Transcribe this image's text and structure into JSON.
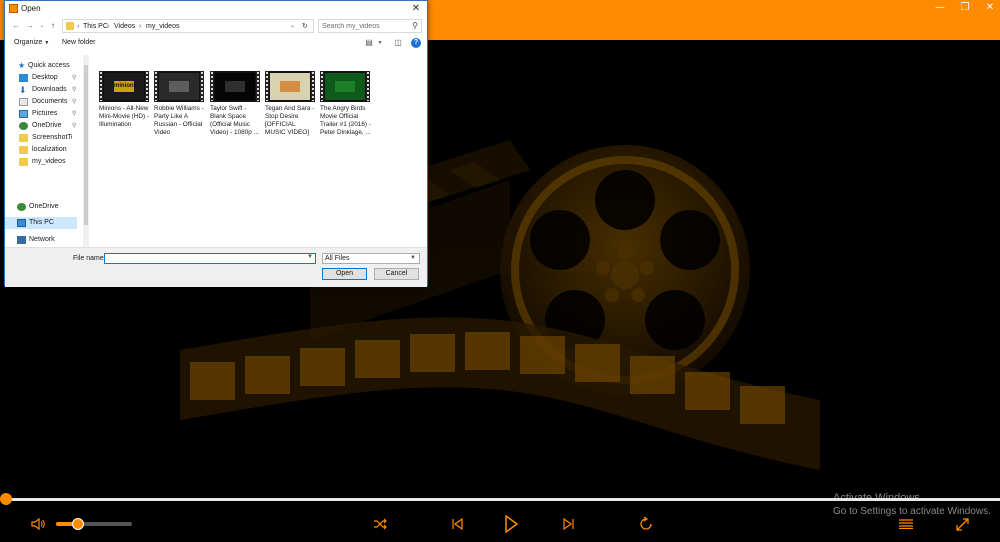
{
  "player": {
    "accent": "#ff8c00",
    "background": "#000000",
    "window_controls": [
      "minimize-icon",
      "maximize-icon",
      "close-icon"
    ],
    "playback_progress": 0,
    "volume_level": 0.3,
    "controls": [
      "volume-icon",
      "shuffle-icon",
      "previous-icon",
      "play-icon",
      "next-icon",
      "repeat-icon",
      "playlist-icon",
      "fullscreen-icon"
    ]
  },
  "watermark": {
    "line1": "Activate Windows",
    "line2": "Go to Settings to activate Windows."
  },
  "dialog": {
    "title": "Open",
    "breadcrumb": [
      "This PC",
      "Videos",
      "my_videos"
    ],
    "search_placeholder": "Search my_videos",
    "toolbar": {
      "organize": "Organize",
      "new_folder": "New folder"
    },
    "sidebar": {
      "quick_access": "Quick access",
      "items": [
        {
          "label": "Desktop",
          "icon": "desktop-icon",
          "pinned": true
        },
        {
          "label": "Downloads",
          "icon": "download-icon",
          "pinned": true
        },
        {
          "label": "Documents",
          "icon": "document-icon",
          "pinned": true
        },
        {
          "label": "Pictures",
          "icon": "picture-icon",
          "pinned": true
        },
        {
          "label": "OneDrive",
          "icon": "onedrive-icon",
          "pinned": true
        },
        {
          "label": "ScreenshotTo",
          "icon": "folder-icon",
          "pinned": false
        },
        {
          "label": "localization",
          "icon": "folder-icon",
          "pinned": false
        },
        {
          "label": "my_videos",
          "icon": "folder-icon",
          "pinned": false
        }
      ],
      "onedrive": "OneDrive",
      "this_pc": "This PC",
      "network": "Network"
    },
    "files": [
      {
        "name": "Minions - All-New Mini-Movie (HD) - Illumination",
        "thumb_bg": "#1a1a1a",
        "thumb_accent": "#f5c400",
        "thumb_text": "minions"
      },
      {
        "name": "Robbie Williams - Party Like A Russian - Official Video",
        "thumb_bg": "#2a2a2a",
        "thumb_accent": "#6a6a6a",
        "thumb_text": ""
      },
      {
        "name": "Taylor Swift - Blank Space (Official Music Video) - 1080p ...",
        "thumb_bg": "#050505",
        "thumb_accent": "#3a3a3a",
        "thumb_text": ""
      },
      {
        "name": "Tegan And Sara - Stop Desire [OFFICIAL MUSIC VIDEO]",
        "thumb_bg": "#d9d2b0",
        "thumb_accent": "#d47a2a",
        "thumb_text": ""
      },
      {
        "name": "The Angry Birds Movie Official Trailer #1 (2016) - Peter Dinklage, ...",
        "thumb_bg": "#0f5a1a",
        "thumb_accent": "#1e8a2a",
        "thumb_text": ""
      }
    ],
    "file_name_label": "File name:",
    "file_name_value": "",
    "file_type": "All Files",
    "open_button": "Open",
    "cancel_button": "Cancel"
  }
}
